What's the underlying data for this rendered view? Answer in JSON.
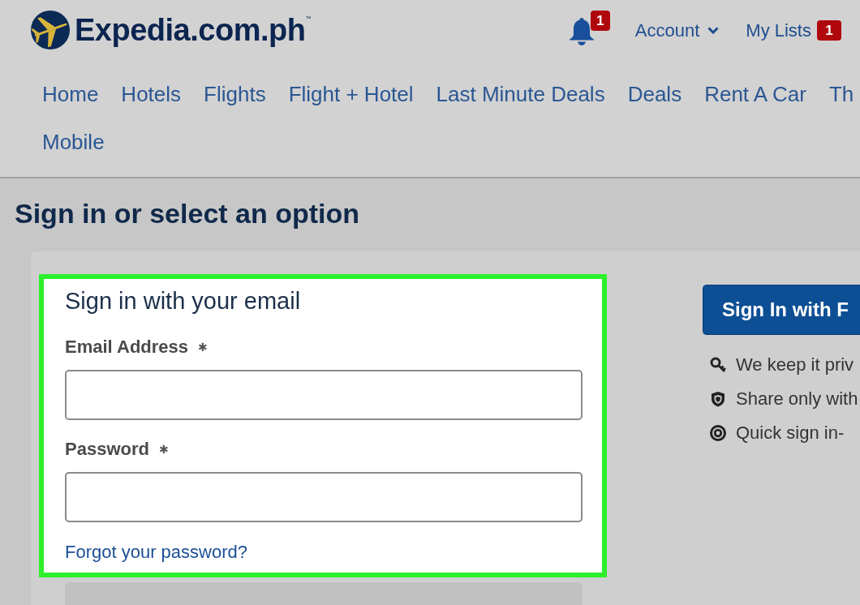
{
  "logo": {
    "text": "Expedia.com.ph$^{™}$"
  },
  "header": {
    "notifications": {
      "badge": "1"
    },
    "account": {
      "label": "Account"
    },
    "my_lists": {
      "label": "My Lists",
      "badge": "1"
    }
  },
  "nav": [
    "Home",
    "Hotels",
    "Flights",
    "Flight + Hotel",
    "Last Minute Deals",
    "Deals",
    "Rent A Car",
    "Th",
    "Mobile"
  ],
  "main": {
    "heading": "Sign in or select an option",
    "email_form": {
      "title": "Sign in with your email",
      "fields": [
        {
          "label": "Email Address",
          "required_mark": "✱"
        },
        {
          "label": "Password",
          "required_mark": "✱"
        }
      ],
      "forgot_link": "Forgot your password?"
    },
    "social": {
      "button": "Sign In with F",
      "benefits": [
        {
          "kind": "key",
          "text": "We keep it priv"
        },
        {
          "kind": "shield",
          "text": "Share only with"
        },
        {
          "kind": "ring",
          "text": "Quick sign in-"
        }
      ]
    }
  }
}
